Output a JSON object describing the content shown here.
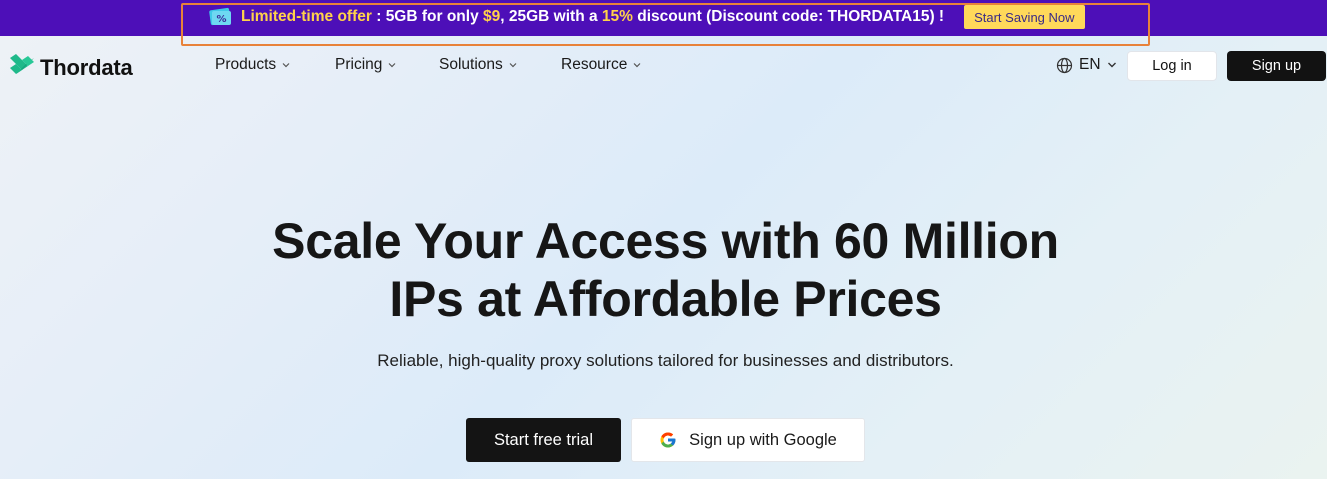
{
  "promo": {
    "offer_label": "Limited-time offer",
    "sep": " : ",
    "part1": "5GB for only ",
    "price": "$9",
    "part2": ", 25GB with a ",
    "discount": "15%",
    "part3": " discount (Discount code: THORDATA15) !",
    "cta": "Start Saving Now",
    "icon": "coupon-percent-icon"
  },
  "brand": {
    "name": "Thordata",
    "logo_icon": "thordata-logo-icon",
    "accent": "#1fb98a"
  },
  "nav": {
    "items": [
      {
        "label": "Products"
      },
      {
        "label": "Pricing"
      },
      {
        "label": "Solutions"
      },
      {
        "label": "Resource"
      }
    ],
    "language": "EN",
    "login": "Log in",
    "signup": "Sign up"
  },
  "hero": {
    "title_line1": "Scale Your Access with 60 Million",
    "title_line2": "IPs at Affordable Prices",
    "subtitle": "Reliable, high-quality proxy solutions tailored for businesses and distributors.",
    "cta_primary": "Start free trial",
    "cta_google": "Sign up with Google"
  },
  "colors": {
    "promo_bg": "#4d0fb8",
    "promo_highlight": "#ffd24a",
    "promo_button": "#ffd95a",
    "dark_button": "#121212",
    "annotation_border": "#e8823a"
  }
}
